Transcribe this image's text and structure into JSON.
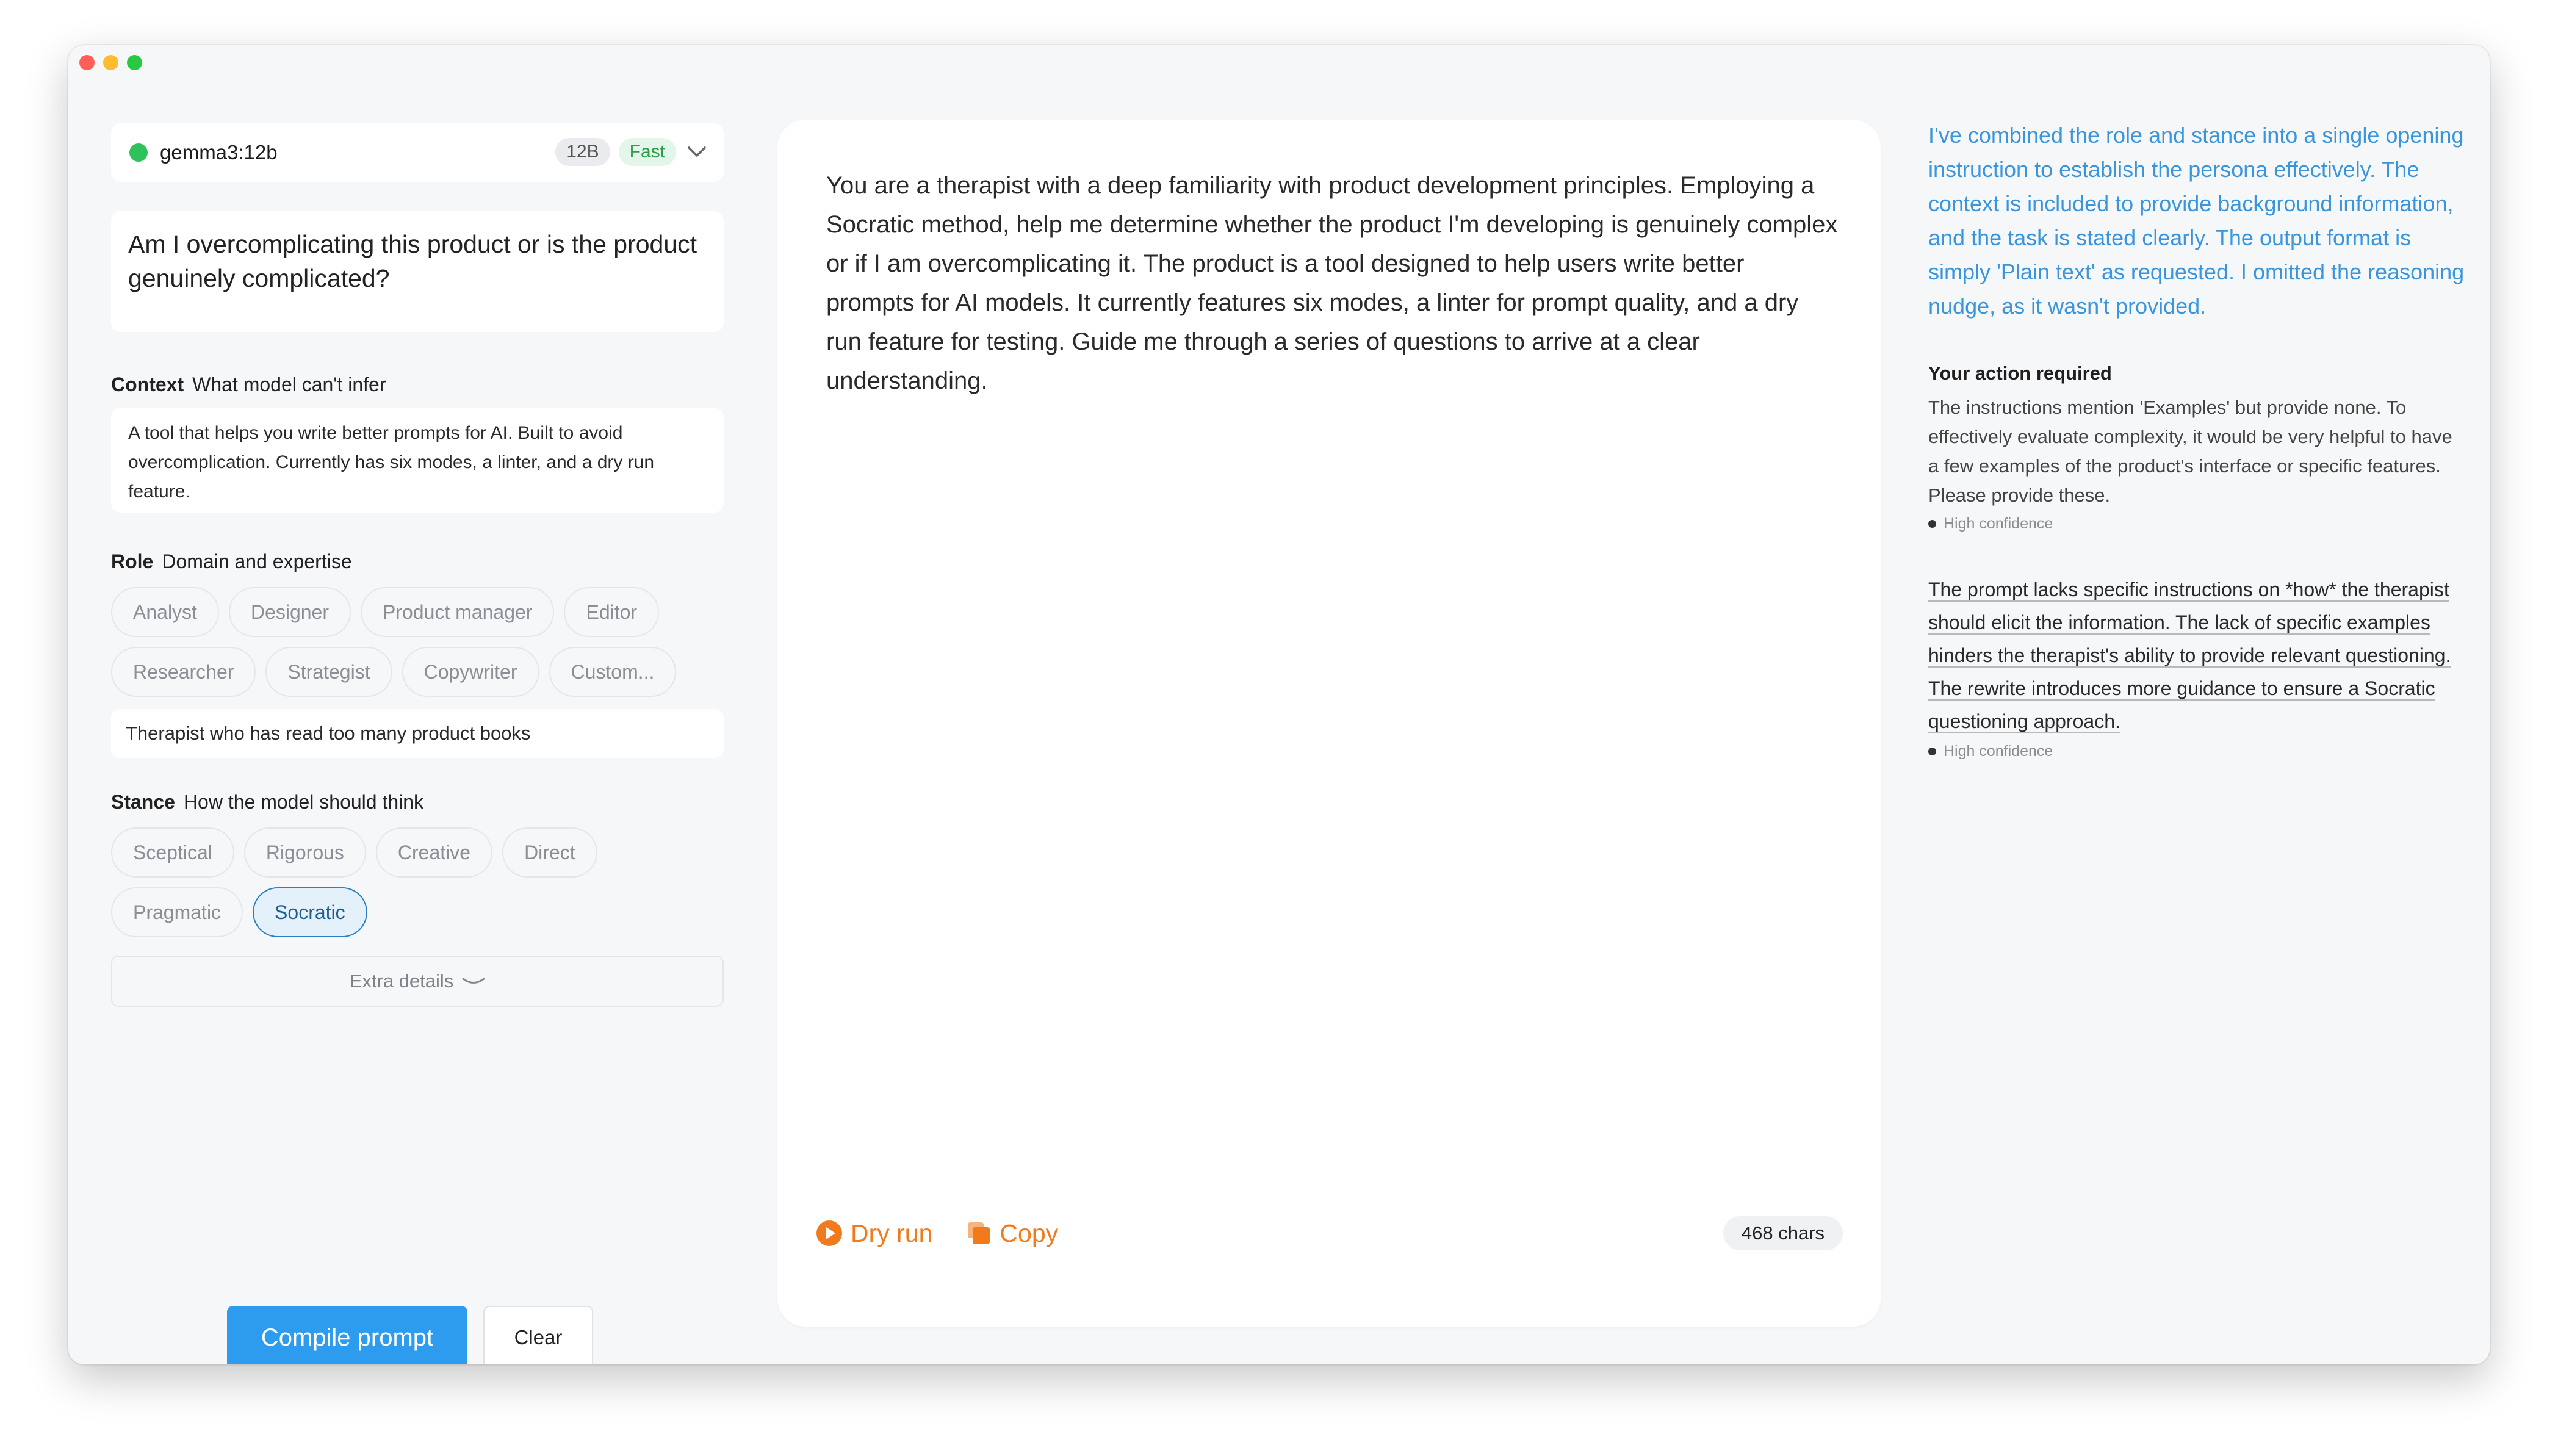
{
  "model": {
    "name": "gemma3:12b",
    "size_badge": "12B",
    "speed_badge": "Fast",
    "status_color": "#2ec35a"
  },
  "question": "Am I overcomplicating this product or is the product genuinely complicated?",
  "context": {
    "label": "Context",
    "hint": "What model can't infer",
    "value": "A tool that helps you write better prompts for AI. Built to avoid overcomplication. Currently has six modes, a linter, and a dry run feature."
  },
  "role": {
    "label": "Role",
    "hint": "Domain and expertise",
    "options": [
      "Analyst",
      "Designer",
      "Product manager",
      "Editor",
      "Researcher",
      "Strategist",
      "Copywriter",
      "Custom..."
    ],
    "custom_value": "Therapist who has read too many product books"
  },
  "stance": {
    "label": "Stance",
    "hint": "How the model should think",
    "options": [
      "Sceptical",
      "Rigorous",
      "Creative",
      "Direct",
      "Pragmatic",
      "Socratic"
    ],
    "selected": "Socratic"
  },
  "extra_details_label": "Extra details",
  "buttons": {
    "compile": "Compile prompt",
    "clear": "Clear"
  },
  "output": {
    "text": "You are a therapist with a deep familiarity with product development principles. Employing a Socratic method, help me determine whether the product I'm developing is genuinely complex or if I am overcomplicating it. The product is a tool designed to help users write better prompts for AI models. It currently features six modes, a linter for prompt quality, and a dry run feature for testing. Guide me through a series of questions to arrive at a clear understanding.",
    "dry_run_label": "Dry run",
    "copy_label": "Copy",
    "char_count": "468 chars",
    "accent_color": "#f07a1c"
  },
  "feedback": {
    "explanation": "I've combined the role and stance into a single opening instruction to establish the persona effectively. The context is included to provide background information, and the task is stated clearly. The output format is simply 'Plain text' as requested. I omitted the reasoning nudge, as it wasn't provided.",
    "action_title": "Your action required",
    "action_body": "The instructions mention 'Examples' but provide none. To effectively evaluate complexity, it would be very helpful to have a few examples of the product's interface or specific features. Please provide these.",
    "action_confidence": "High confidence",
    "issue_text": "The prompt lacks specific instructions on *how* the therapist should elicit the information. The lack of specific examples hinders the therapist's ability to provide relevant questioning. The rewrite introduces more guidance to ensure a Socratic questioning approach.",
    "issue_confidence": "High confidence",
    "explanation_color": "#3a95dc"
  }
}
